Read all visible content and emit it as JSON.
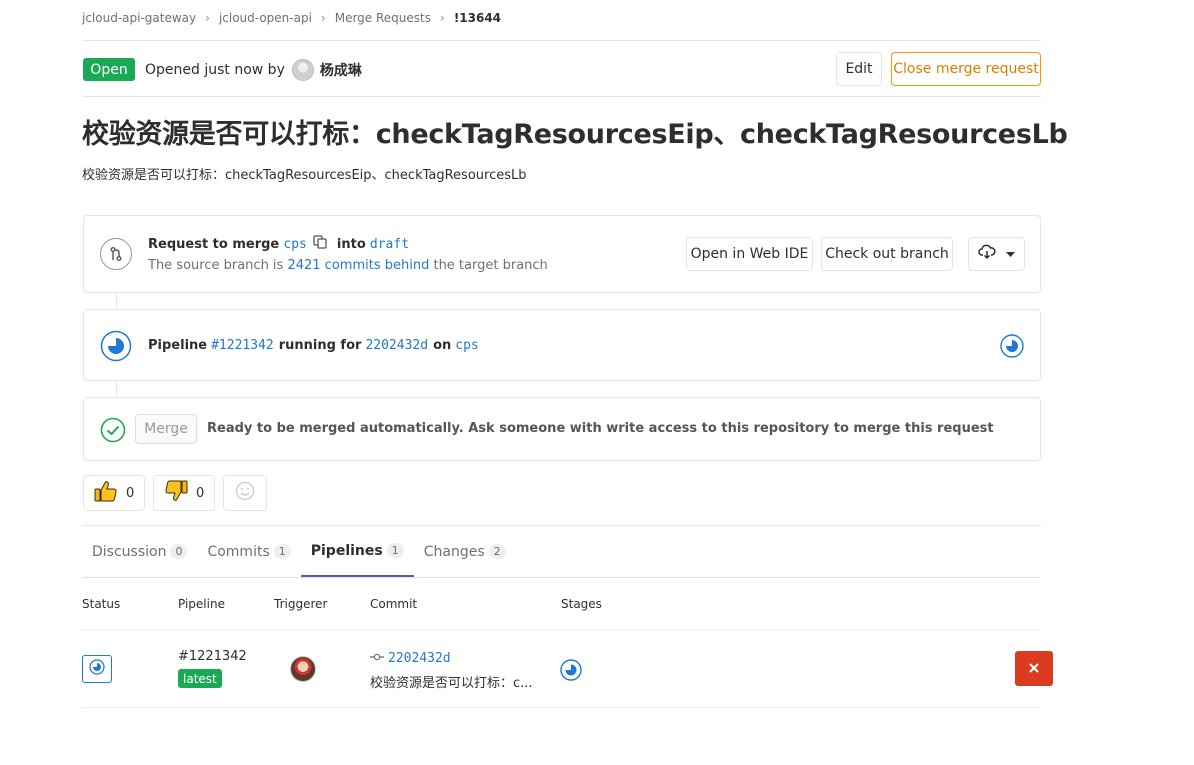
{
  "breadcrumb": {
    "items": [
      "jcloud-api-gateway",
      "jcloud-open-api",
      "Merge Requests",
      "!13644"
    ],
    "separator": "›"
  },
  "header": {
    "status": "Open",
    "opened_text": "Opened just now by",
    "author": "杨成琳",
    "edit_label": "Edit",
    "close_label": "Close merge request"
  },
  "title": "校验资源是否可以打标：checkTagResourcesEip、checkTagResourcesLb",
  "description": "校验资源是否可以打标：checkTagResourcesEip、checkTagResourcesLb",
  "request": {
    "request_to_merge": "Request to merge",
    "source_branch": "cps",
    "into": "into",
    "target_branch": "draft",
    "behind_prefix": "The source branch is",
    "behind_link": "2421 commits behind",
    "behind_suffix": "the target branch",
    "open_web_ide": "Open in Web IDE",
    "check_out_branch": "Check out branch"
  },
  "pipeline_widget": {
    "pipeline_label": "Pipeline",
    "pipeline_id": "#1221342",
    "running_for": "running for",
    "commit_sha": "2202432d",
    "on": "on",
    "branch": "cps"
  },
  "merge_widget": {
    "merge_label": "Merge",
    "message": "Ready to be merged automatically. Ask someone with write access to this repository to merge this request"
  },
  "awards": {
    "thumbs_up_count": "0",
    "thumbs_down_count": "0"
  },
  "tabs": [
    {
      "label": "Discussion",
      "count": "0"
    },
    {
      "label": "Commits",
      "count": "1"
    },
    {
      "label": "Pipelines",
      "count": "1"
    },
    {
      "label": "Changes",
      "count": "2"
    }
  ],
  "active_tab": "Pipelines",
  "table": {
    "headers": [
      "Status",
      "Pipeline",
      "Triggerer",
      "Commit",
      "Stages"
    ],
    "rows": [
      {
        "pipeline_id": "#1221342",
        "badge": "latest",
        "commit_sha": "2202432d",
        "commit_message": "校验资源是否可以打标：c..."
      }
    ]
  },
  "colors": {
    "open_green": "#1aaa55",
    "link_blue": "#1f78d1",
    "close_orange": "#fc9403",
    "cancel_red": "#db3b21",
    "tab_active": "#6b4fbb"
  }
}
